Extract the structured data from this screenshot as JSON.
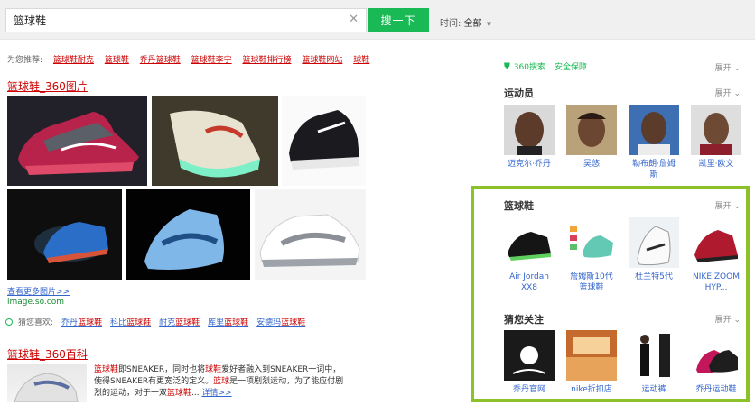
{
  "search": {
    "query": "篮球鞋",
    "clear": "✕",
    "button": "搜一下"
  },
  "time_filter": {
    "label": "时间:",
    "value": "全部"
  },
  "recommend": {
    "prefix": "为您推荐:",
    "items": [
      "篮球鞋耐克",
      "篮球鞋",
      "乔丹篮球鞋",
      "篮球鞋李宁",
      "篮球鞋排行榜",
      "篮球鞋网站",
      "球鞋"
    ]
  },
  "images_result": {
    "title": "篮球鞋_360图片",
    "more": "查看更多图片>>",
    "source": "image.so.com"
  },
  "guess": {
    "prefix": "猜您喜欢:",
    "items": [
      {
        "pre": "乔丹",
        "hl": "篮球鞋"
      },
      {
        "pre": "科比",
        "hl": "篮球鞋"
      },
      {
        "pre": "耐克",
        "hl": "篮球鞋"
      },
      {
        "pre": "库里",
        "hl": "篮球鞋"
      },
      {
        "pre": "安德玛",
        "hl": "篮球鞋"
      }
    ]
  },
  "baike_result": {
    "title": "篮球鞋_360百科",
    "line1_hl1": "篮球鞋",
    "line1_a": "即SNEAKER，同时也将",
    "line1_hl2": "球鞋",
    "line1_b": "爱好者融入到SNEAKER一词中，",
    "line2_a": "使得SNEAKER有更宽泛的定义。",
    "line2_hl": "篮球",
    "line2_b": "是一项剧烈运动，为了能应付剧",
    "line3_a": "烈的运动，对于一双",
    "line3_hl": "篮球鞋",
    "line3_b": "...",
    "more": "详情>>"
  },
  "sidebar": {
    "safe": {
      "label": "360搜索",
      "label2": "安全保障",
      "expand": "展开"
    },
    "athletes": {
      "title": "运动员",
      "expand": "展开",
      "items": [
        "迈克尔·乔丹",
        "吴悠",
        "勒布朗·詹姆斯",
        "凯里·欧文"
      ]
    },
    "shoes": {
      "title": "篮球鞋",
      "expand": "展开",
      "items": [
        "Air Jordan XX8",
        "詹姆斯10代篮球鞋",
        "杜兰特5代",
        "NIKE ZOOM HYP..."
      ]
    },
    "guess": {
      "title": "猜您关注",
      "expand": "展开",
      "items": [
        "乔丹官网",
        "nike折扣店",
        "运动裤",
        "乔丹运动鞋"
      ]
    }
  },
  "colors": {
    "accent_green": "#19b955",
    "link_red": "#cc0000",
    "link_blue": "#3366cc",
    "highlight_border": "#8cc12a"
  }
}
